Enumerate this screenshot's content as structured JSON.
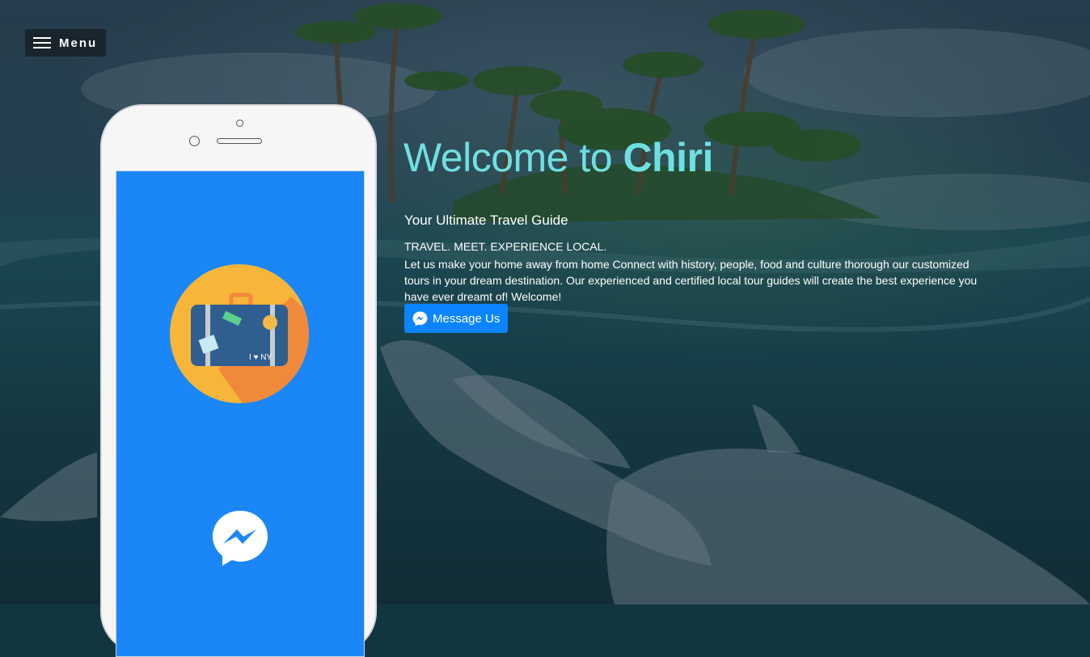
{
  "menu": {
    "label": "Menu"
  },
  "hero": {
    "title_prefix": "Welcome to ",
    "title_brand": "Chiri",
    "subtitle": "Your Ultimate Travel Guide",
    "tagline": "TRAVEL. MEET. EXPERIENCE LOCAL.",
    "description": "Let us make your home away from home Connect with history, people, food and culture thorough our customized tours in your dream destination. Our experienced and certified local tour guides will create the best experience you have ever dreamt of! Welcome!"
  },
  "cta": {
    "label": "Message Us"
  },
  "colors": {
    "title": "#6fe0e0",
    "button": "#0a84ff",
    "phone_screen": "#1b86f7",
    "suitcase_circle": "#f7b53a"
  },
  "icons": {
    "menu": "hamburger-icon",
    "cta": "messenger-icon",
    "phone_logo": "messenger-logo",
    "phone_illustration": "suitcase-icon"
  }
}
